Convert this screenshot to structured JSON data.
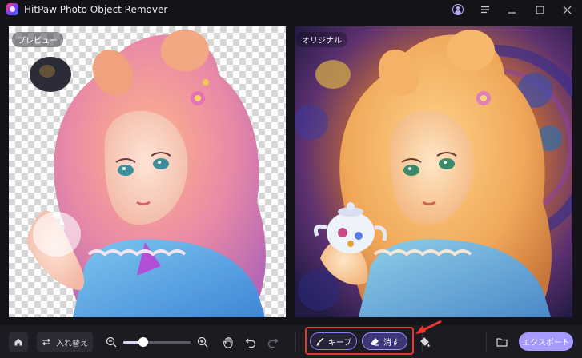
{
  "window": {
    "title": "HitPaw Photo Object Remover"
  },
  "titlebar_icons": [
    "user-icon",
    "menu-icon",
    "minimize-icon",
    "maximize-icon",
    "close-icon"
  ],
  "panels": {
    "preview_label": "プレビュー",
    "original_label": "オリジナル"
  },
  "toolbar": {
    "swap_label": "入れ替え",
    "zoom_level": 0.3,
    "keep_label": "キープ",
    "erase_label": "消す",
    "export_label": "エクスポート"
  },
  "colors": {
    "accent": "#a79aff",
    "highlight": "#e8372c",
    "background": "#141418"
  }
}
